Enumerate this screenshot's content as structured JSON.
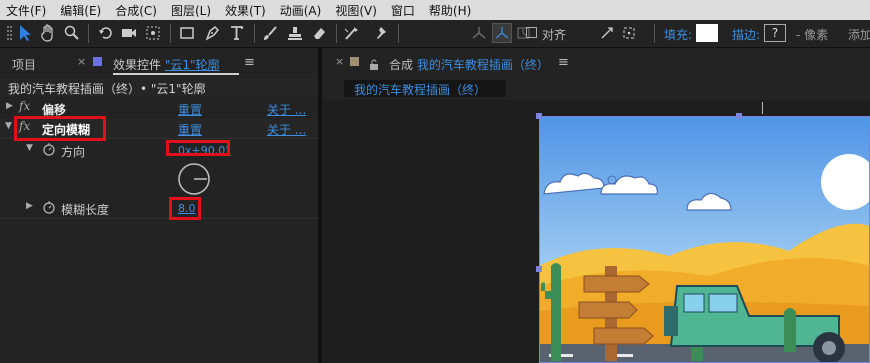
{
  "menu": [
    "文件(F)",
    "编辑(E)",
    "合成(C)",
    "图层(L)",
    "效果(T)",
    "动画(A)",
    "视图(V)",
    "窗口",
    "帮助(H)"
  ],
  "toolbar": {
    "align_label": "对齐",
    "fill_label": "填充:",
    "stroke_label": "描边:",
    "stroke_value": "?",
    "pixel_label": "- 像素",
    "add_label": "添加"
  },
  "left_panel": {
    "tab_project": "项目",
    "tab_effects_prefix": "效果控件",
    "tab_effects_layer": "\"云1\"轮廓",
    "breadcrumb": "我的汽车教程插画（终）• \"云1\"轮廓",
    "effects": [
      {
        "name": "偏移",
        "reset": "重置",
        "about": "关于 ..."
      },
      {
        "name": "定向模糊",
        "reset": "重置",
        "about": "关于 ..."
      }
    ],
    "props": [
      {
        "name": "方向",
        "value": "0x+90.0°"
      },
      {
        "name": "模糊长度",
        "value": "8.0"
      }
    ]
  },
  "right_panel": {
    "tab_prefix": "合成",
    "tab_comp": "我的汽车教程插画（终）",
    "subtab": "我的汽车教程插画（终）"
  },
  "colors": {
    "accent": "#3d8ee0",
    "highlight": "#e3101a",
    "sky": "#5da2e8",
    "sand": "#f3bb33"
  }
}
